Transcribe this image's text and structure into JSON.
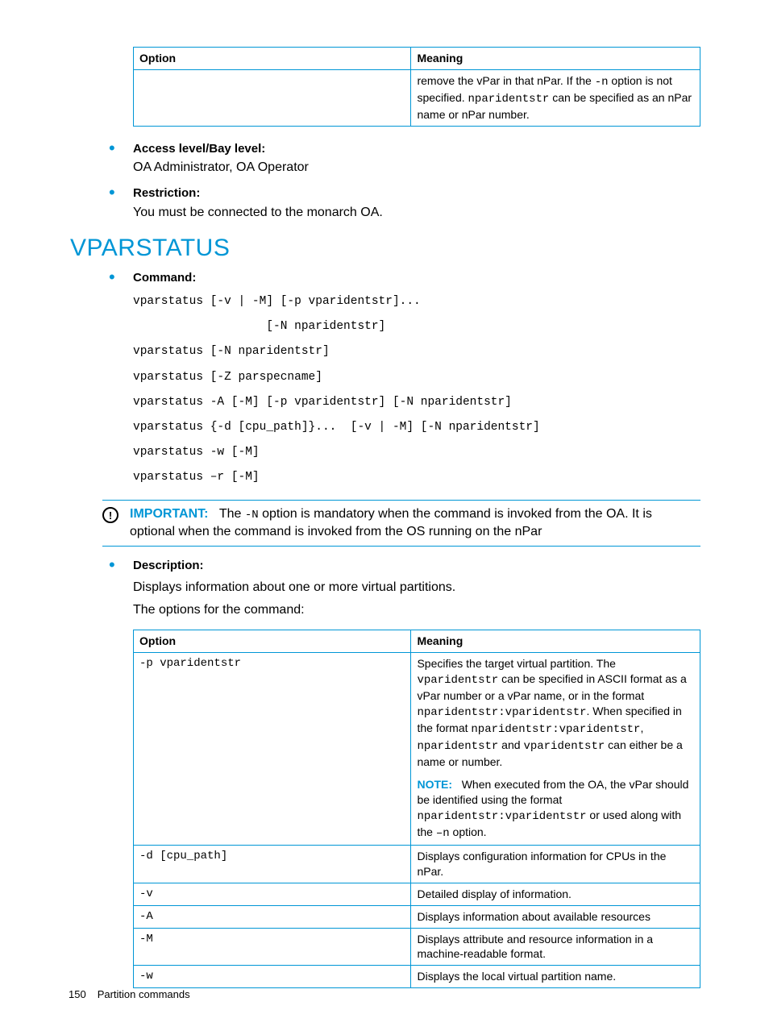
{
  "topTable": {
    "headers": [
      "Option",
      "Meaning"
    ],
    "row": {
      "opt": "",
      "meaning_pre": "remove the vPar in that nPar. If the ",
      "meaning_code1": "-n",
      "meaning_mid": " option is not specified. ",
      "meaning_code2": "nparidentstr",
      "meaning_post": " can be specified as an nPar name or nPar number."
    }
  },
  "access": {
    "label": "Access level/Bay level:",
    "text": "OA Administrator, OA Operator"
  },
  "restriction": {
    "label": "Restriction:",
    "text": "You must be connected to the monarch OA."
  },
  "sectionTitle": "VPARSTATUS",
  "command": {
    "label": "Command:",
    "text": "vparstatus [-v | -M] [-p vparidentstr]...\n                   [-N nparidentstr]\nvparstatus [-N nparidentstr]\nvparstatus [-Z parspecname]\nvparstatus -A [-M] [-p vparidentstr] [-N nparidentstr]\nvparstatus {-d [cpu_path]}...  [-v | -M] [-N nparidentstr]\nvparstatus -w [-M]\nvparstatus –r [-M]"
  },
  "important": {
    "label": "IMPORTANT:",
    "pre": "The ",
    "code": "-N",
    "post": " option is mandatory when the command is invoked from the OA. It is optional when the command is invoked from the OS running on the nPar"
  },
  "description": {
    "label": "Description:",
    "line1": "Displays information about one or more virtual partitions.",
    "line2": "The options for the command:"
  },
  "optTable": {
    "headers": [
      "Option",
      "Meaning"
    ],
    "rows": [
      {
        "opt": "-p vparidentstr",
        "m": {
          "t1": "Specifies the target virtual partition. The ",
          "c1": "vparidentstr",
          "t2": " can be specified in ASCII format as a vPar number or a vPar name, or in the format ",
          "c2": "nparidentstr:vparidentstr",
          "t3": ". When specified in the format ",
          "c3": "nparidentstr:vparidentstr",
          "t4": ", ",
          "c4": "nparidentstr",
          "t5": " and ",
          "c5": "vparidentstr",
          "t6": " can either be a name or number.",
          "noteLabel": "NOTE:",
          "n1": "When executed from the OA, the vPar should be identified using the format ",
          "nc1": "nparidentstr:vparidentstr",
          "n2": " or used along with the ",
          "nc2": "–n",
          "n3": " option."
        }
      },
      {
        "opt": "-d [cpu_path]",
        "plain": "Displays configuration information for CPUs in the nPar."
      },
      {
        "opt": "-v",
        "plain": "Detailed display of information."
      },
      {
        "opt": "-A",
        "plain": "Displays information about available resources"
      },
      {
        "opt": "-M",
        "plain": "Displays attribute and resource information in a machine-readable format."
      },
      {
        "opt": "-w",
        "plain": "Displays the local virtual partition name."
      }
    ]
  },
  "footer": {
    "page": "150",
    "title": "Partition commands"
  }
}
